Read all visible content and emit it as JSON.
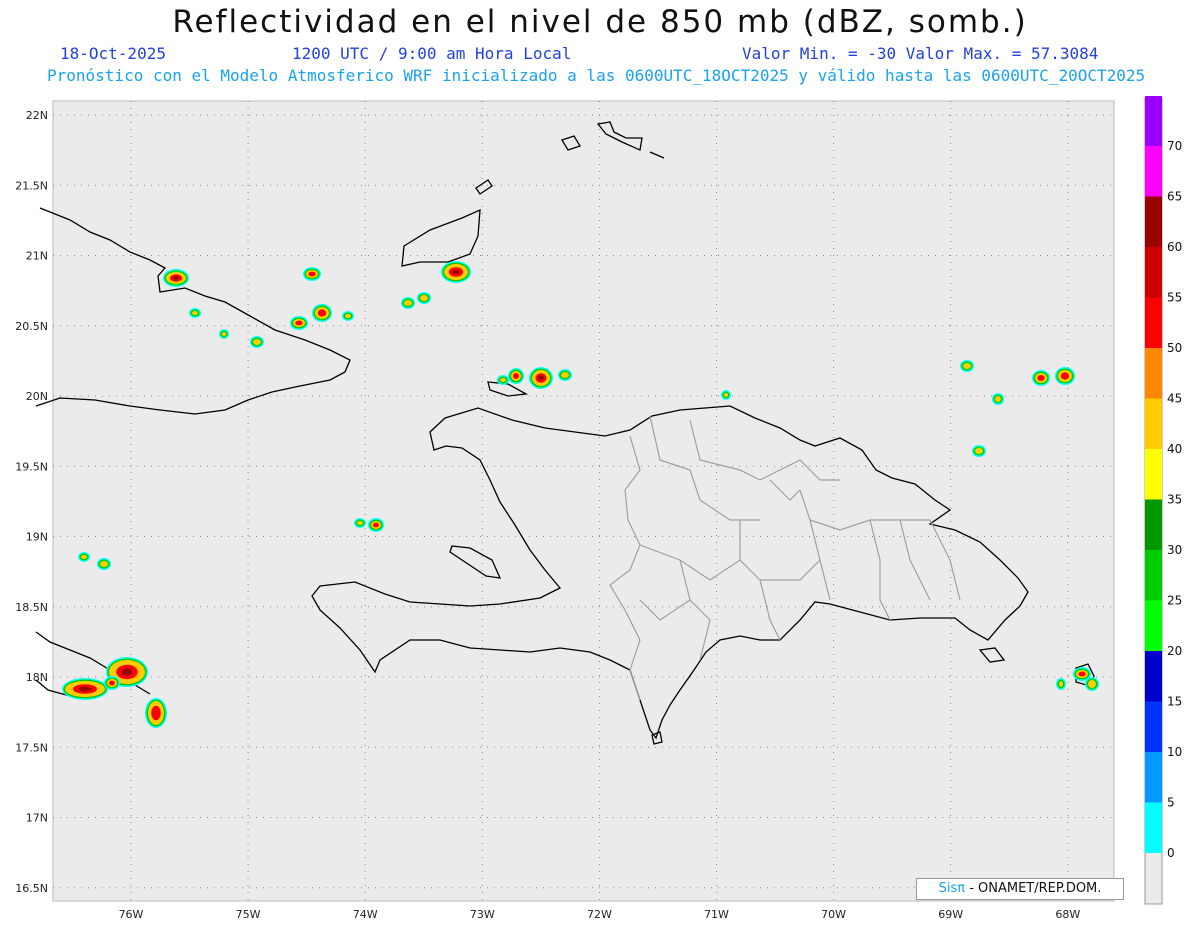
{
  "header": {
    "title": "Reflectividad en el nivel de 850 mb (dBZ, somb.)",
    "date": "18-Oct-2025",
    "time": "1200 UTC / 9:00 am Hora Local",
    "minmax": "Valor Min. = -30  Valor Max. = 57.3084",
    "forecast": "Pronóstico con el Modelo Atmosferico WRF inicializado a las 0600UTC_18OCT2025 y válido hasta las  0600UTC_20OCT2025"
  },
  "map": {
    "lat_labels": [
      "22N",
      "21.5N",
      "21N",
      "20.5N",
      "20N",
      "19.5N",
      "19N",
      "18.5N",
      "18N",
      "17.5N",
      "17N",
      "16.5N"
    ],
    "lon_labels": [
      "76W",
      "75W",
      "74W",
      "73W",
      "72W",
      "71W",
      "70W",
      "69W",
      "68W"
    ],
    "lat_values": [
      22,
      21.5,
      21,
      20.5,
      20,
      19.5,
      19,
      18.5,
      18,
      17.5,
      17,
      16.5
    ],
    "lon_values": [
      -76,
      -75,
      -74,
      -73,
      -72,
      -71,
      -70,
      -69,
      -68
    ],
    "background_color": "#ebebeb"
  },
  "colorbar": {
    "ticks": [
      "0",
      "5",
      "10",
      "15",
      "20",
      "25",
      "30",
      "35",
      "40",
      "45",
      "50",
      "55",
      "60",
      "65",
      "70"
    ],
    "colors": [
      "#00ffff",
      "#0099ff",
      "#0033ff",
      "#0000cc",
      "#00ff00",
      "#00cc00",
      "#009900",
      "#ffff00",
      "#ffcc00",
      "#ff8800",
      "#ff0000",
      "#cc0000",
      "#990000",
      "#ff00ff",
      "#9900ff"
    ]
  },
  "credit": {
    "logo": "Sisπ",
    "text": " - ONAMET/REP.DOM."
  }
}
